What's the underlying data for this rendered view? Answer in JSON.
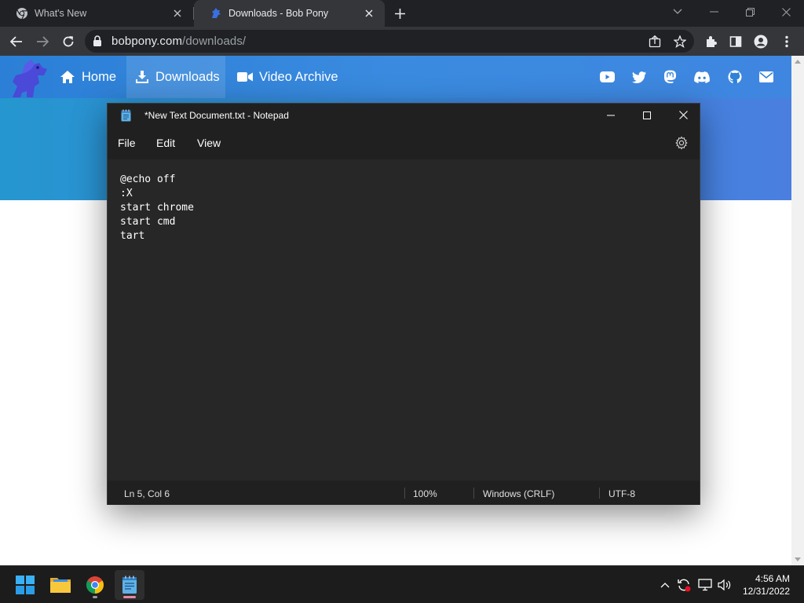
{
  "browser": {
    "tabs": [
      {
        "title": "What's New",
        "active": false
      },
      {
        "title": "Downloads - Bob Pony",
        "active": true
      }
    ],
    "url_host": "bobpony.com",
    "url_path": "/downloads/"
  },
  "site": {
    "nav": [
      {
        "label": "Home",
        "icon": "home-icon"
      },
      {
        "label": "Downloads",
        "icon": "download-icon",
        "active": true
      },
      {
        "label": "Video Archive",
        "icon": "video-camera-icon"
      }
    ],
    "social_icons": [
      "youtube-icon",
      "twitter-icon",
      "mastodon-icon",
      "discord-icon",
      "github-icon",
      "email-icon"
    ]
  },
  "notepad": {
    "title": "*New Text Document.txt - Notepad",
    "menu": [
      "File",
      "Edit",
      "View"
    ],
    "lines": [
      "@echo off",
      ":X",
      "start chrome",
      "start cmd",
      "tart"
    ],
    "status": {
      "position": "Ln 5, Col 6",
      "zoom": "100%",
      "line_ending": "Windows (CRLF)",
      "encoding": "UTF-8"
    }
  },
  "taskbar": {
    "time": "4:56 AM",
    "date": "12/31/2022"
  },
  "colors": {
    "site_nav": "#2b7fd6",
    "notepad_bg": "#272727",
    "chrome_frame": "#202124"
  }
}
